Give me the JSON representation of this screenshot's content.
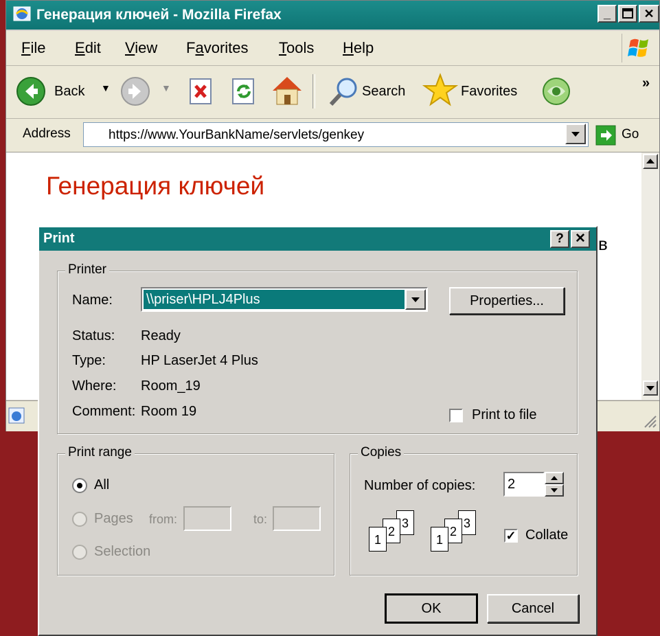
{
  "browser": {
    "title": "Генерация ключей - Mozilla Firefax",
    "menu": [
      "File",
      "Edit",
      "View",
      "Favorites",
      "Tools",
      "Help"
    ],
    "menu_hotkeys": [
      "F",
      "E",
      "V",
      "a",
      "T",
      "H"
    ],
    "toolbar": {
      "back_label": "Back",
      "search_label": "Search",
      "favorites_label": "Favorites",
      "more": "»"
    },
    "address": {
      "label": "Address",
      "url": "https://www.YourBankName/servlets/genkey",
      "go_label": "Go"
    },
    "page": {
      "heading": "Генерация ключей",
      "trailing_text": "в"
    }
  },
  "dialog": {
    "title": "Print",
    "help": "?",
    "close": "✕",
    "printer": {
      "legend": "Printer",
      "name_label": "Name:",
      "name_value": "\\\\priser\\HPLJ4Plus",
      "properties_button": "Properties...",
      "status_label": "Status:",
      "status_value": "Ready",
      "type_label": "Type:",
      "type_value": "HP LaserJet 4 Plus",
      "where_label": "Where:",
      "where_value": "Room_19",
      "comment_label": "Comment:",
      "comment_value": "Room 19",
      "print_to_file_label": "Print to file",
      "print_to_file_checked": false
    },
    "range": {
      "legend": "Print range",
      "all_label": "All",
      "pages_label": "Pages",
      "from_label": "from:",
      "to_label": "to:",
      "selection_label": "Selection",
      "selected": "All"
    },
    "copies": {
      "legend": "Copies",
      "number_label": "Number of copies:",
      "number_value": "2",
      "collate_label": "Collate",
      "collate_checked": true,
      "page_numbers": [
        "1",
        "2",
        "3"
      ]
    },
    "ok_button": "OK",
    "cancel_button": "Cancel"
  },
  "colors": {
    "desktop": "#8e1c1f",
    "titlebar": "#127a79",
    "heading": "#cc2200"
  }
}
